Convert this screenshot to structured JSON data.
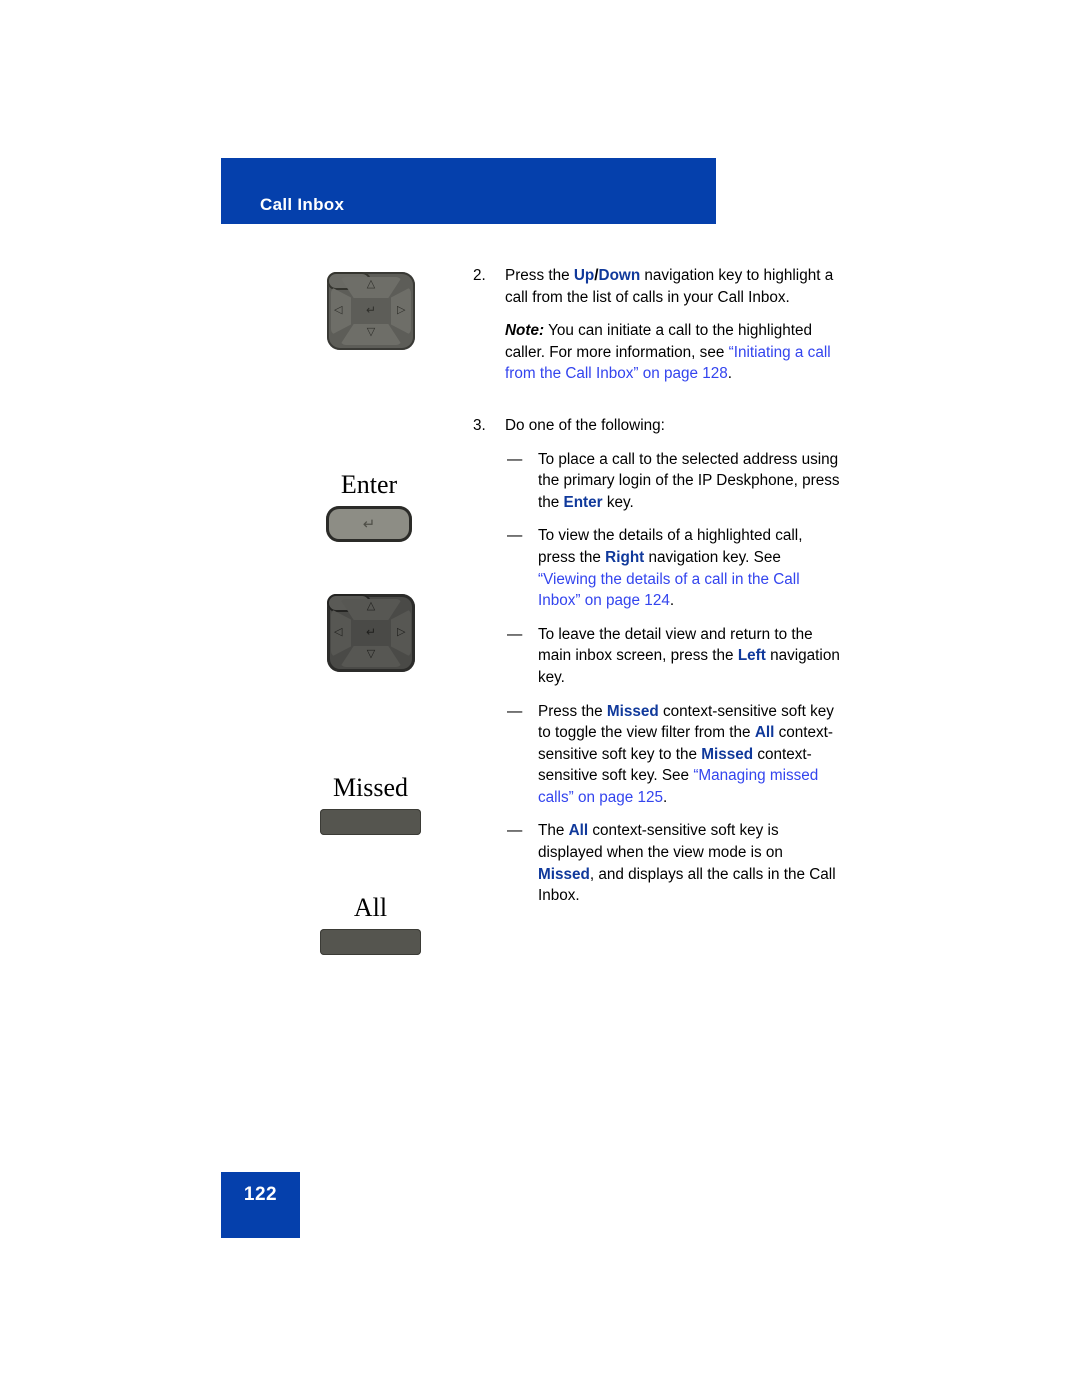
{
  "header": {
    "title": "Call Inbox",
    "bar_color": "#0540ac"
  },
  "footer": {
    "page_number": "122",
    "box_color": "#0540ac"
  },
  "colors": {
    "keyword_blue": "#10399b",
    "xref_blue": "#3344ee",
    "body_text": "#000000"
  },
  "figures": [
    {
      "name": "navigation-key-cluster",
      "caption": "",
      "icon": "navigation-key-icon",
      "arrows": {
        "up": "△",
        "down": "▽",
        "left": "◁",
        "right": "▷",
        "center": "↵"
      }
    },
    {
      "name": "enter-key",
      "caption": "Enter",
      "icon": "enter-key-icon",
      "glyph": "↵"
    },
    {
      "name": "navigation-key-cluster-2",
      "caption": "",
      "icon": "navigation-key-icon",
      "arrows": {
        "up": "△",
        "down": "▽",
        "left": "◁",
        "right": "▷",
        "center": "↵"
      }
    },
    {
      "name": "missed-soft-key",
      "caption": "Missed",
      "icon": "soft-key-icon"
    },
    {
      "name": "all-soft-key",
      "caption": "All",
      "icon": "soft-key-icon"
    }
  ],
  "steps": {
    "step2": {
      "number": "2.",
      "text_part1": "Press the ",
      "kw_up": "Up",
      "separator": "/",
      "kw_down": "Down",
      "text_part2": " navigation key to highlight a call from the list of calls in your Call Inbox.",
      "note_label": "Note:",
      "note_text1": "  You can initiate a call to the highlighted caller. For more information, see ",
      "note_xref": "“Initiating a call from the Call Inbox” on page 128",
      "note_end": "."
    },
    "step3": {
      "number": "3.",
      "intro": "Do one of the following:",
      "dash": "—",
      "bullets": [
        {
          "part1": "To place a call to the selected address using the primary login of the IP Deskphone, press the ",
          "kw": "Enter",
          "part2": " key."
        },
        {
          "part1": "To view the details of a highlighted call, press the ",
          "kw": "Right",
          "part2": " navigation key. See ",
          "xref": "“Viewing the details of a call in the Call Inbox” on page 124",
          "part3": "."
        },
        {
          "part1": "To leave the detail view and return to the main inbox screen, press the ",
          "kw": "Left",
          "part2": " navigation key."
        },
        {
          "part1": "Press the ",
          "kw": "Missed",
          "part2": " context-sensitive soft key to toggle the view filter from the ",
          "kw2": "All",
          "part3": " context-sensitive soft key to the ",
          "kw3": "Missed",
          "part4": " context-sensitive soft key. See ",
          "xref": "“Managing missed calls” on page 125",
          "part5": "."
        },
        {
          "part1": "The ",
          "kw": "All",
          "part2": " context-sensitive soft key is displayed when the view mode is on ",
          "kw2": "Missed",
          "part3": ", and displays all the calls in the Call Inbox."
        }
      ]
    }
  }
}
